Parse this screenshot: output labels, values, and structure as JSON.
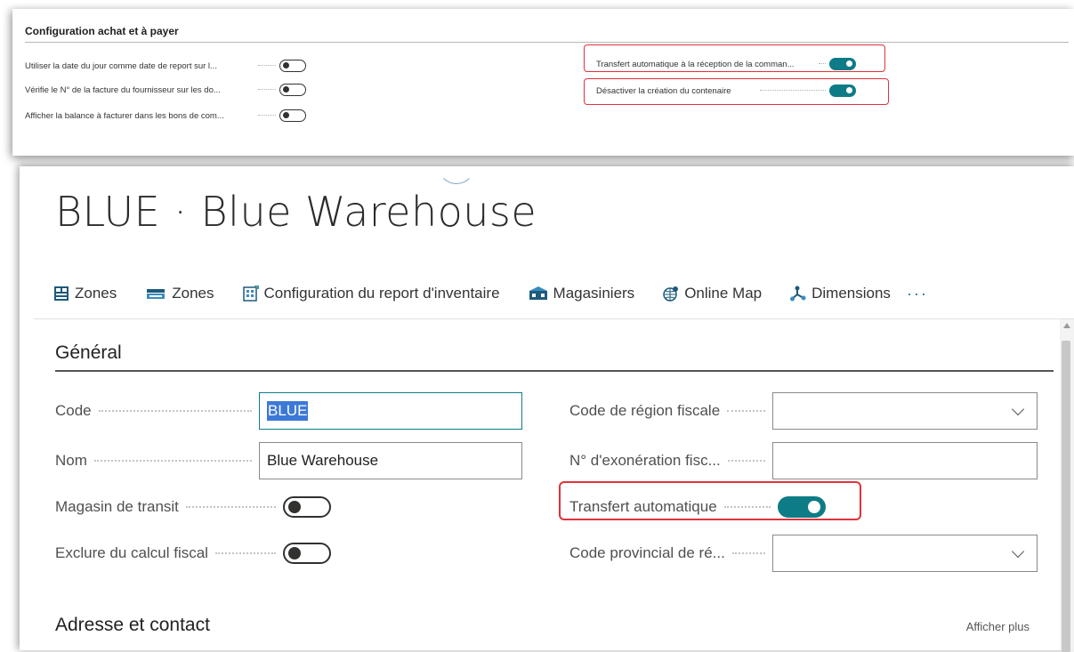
{
  "setup_panel": {
    "title": "Configuration achat et à payer",
    "left_settings": [
      {
        "label": "Utiliser la date du jour comme date de report sur l...",
        "on": false
      },
      {
        "label": "Vérifie le N° de la facture du fournisseur sur les do...",
        "on": false
      },
      {
        "label": "Afficher la balance à facturer dans les bons de com...",
        "on": false
      }
    ],
    "right_settings": [
      {
        "label": "Transfert automatique à la réception de la comman...",
        "on": true
      },
      {
        "label": "Désactiver la création du contenaire",
        "on": true
      }
    ]
  },
  "page": {
    "title": "BLUE · Blue Warehouse"
  },
  "actions": [
    {
      "label": "Zones",
      "icon": "zones-grid-icon"
    },
    {
      "label": "Zones",
      "icon": "zones-tray-icon"
    },
    {
      "label": "Configuration du report d'inventaire",
      "icon": "inventory-posting-setup-icon"
    },
    {
      "label": "Magasiniers",
      "icon": "warehouse-employees-icon"
    },
    {
      "label": "Online Map",
      "icon": "globe-map-icon"
    },
    {
      "label": "Dimensions",
      "icon": "dimensions-icon"
    }
  ],
  "more_label": "···",
  "general": {
    "title": "Général",
    "code_label": "Code",
    "code_value": "BLUE",
    "name_label": "Nom",
    "name_value": "Blue Warehouse",
    "transit_label": "Magasin de transit",
    "transit_on": false,
    "exclude_tax_label": "Exclure du calcul fiscal",
    "exclude_tax_on": false,
    "tax_area_label": "Code de région fiscale",
    "tax_area_value": "",
    "tax_exempt_label": "N° d'exonération fisc...",
    "tax_exempt_value": "",
    "auto_transfer_label": "Transfert automatique",
    "auto_transfer_on": true,
    "province_label": "Code provincial de ré...",
    "province_value": ""
  },
  "address": {
    "title": "Adresse et contact",
    "show_more": "Afficher plus"
  },
  "colors": {
    "accent": "#0e7c86",
    "highlight_box": "#e0323b",
    "selection": "#3c78d8"
  }
}
